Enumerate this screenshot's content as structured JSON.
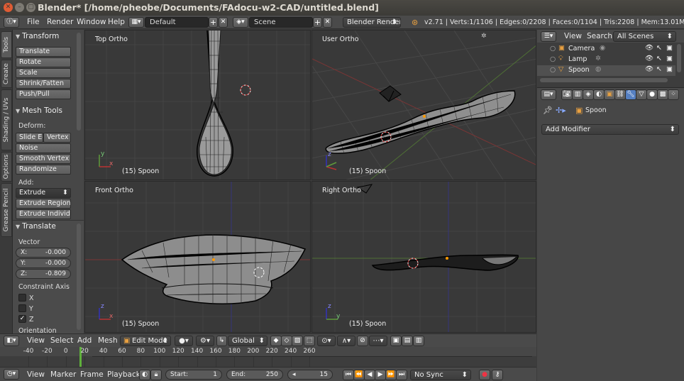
{
  "window": {
    "title": "Blender* [/home/pheobe/Documents/FAdocu-w2-CAD/untitled.blend]"
  },
  "info_header": {
    "menus": [
      "File",
      "Render",
      "Window",
      "Help"
    ],
    "layout": "Default",
    "scene": "Scene",
    "engine": "Blender Render",
    "stats": "v2.71 | Verts:1/1106 | Edges:0/2208 | Faces:0/1104 | Tris:2208 | Mem:13.01M | Spoon"
  },
  "tool_tabs": [
    "Tools",
    "Create",
    "Shading / UVs",
    "Options",
    "Grease Pencil"
  ],
  "toolshelf": {
    "transform": {
      "title": "Transform",
      "buttons": [
        "Translate",
        "Rotate",
        "Scale",
        "Shrink/Fatten",
        "Push/Pull"
      ]
    },
    "mesh_tools": {
      "title": "Mesh Tools",
      "deform_label": "Deform:",
      "slide_edge": "Slide Ed",
      "vertex": "Vertex",
      "noise": "Noise",
      "smooth_vertex": "Smooth Vertex",
      "randomize": "Randomize",
      "add_label": "Add:",
      "extrude": "Extrude",
      "extrude_region": "Extrude Region",
      "extrude_individual": "Extrude Individual"
    },
    "translate": {
      "title": "Translate",
      "vector_label": "Vector",
      "x": {
        "label": "X:",
        "value": "-0.000"
      },
      "y": {
        "label": "Y:",
        "value": "-0.000"
      },
      "z": {
        "label": "Z:",
        "value": "-0.809"
      },
      "constraint_label": "Constraint Axis",
      "axes": [
        {
          "label": "X",
          "checked": false
        },
        {
          "label": "Y",
          "checked": false
        },
        {
          "label": "Z",
          "checked": true
        }
      ],
      "orientation_label": "Orientation"
    }
  },
  "viewports": {
    "top": {
      "name": "Top Ortho",
      "object": "(15) Spoon"
    },
    "user": {
      "name": "User Ortho",
      "object": "(15) Spoon"
    },
    "front": {
      "name": "Front Ortho",
      "object": "(15) Spoon"
    },
    "right": {
      "name": "Right Ortho",
      "object": "(15) Spoon"
    }
  },
  "view3d_header": {
    "menus": [
      "View",
      "Select",
      "Add",
      "Mesh"
    ],
    "mode": "Edit Mode",
    "orientation": "Global"
  },
  "timeline": {
    "ticks": [
      "-40",
      "-20",
      "0",
      "20",
      "40",
      "60",
      "80",
      "100",
      "120",
      "140",
      "160",
      "180",
      "200",
      "220",
      "240",
      "260"
    ],
    "current_frame": 15,
    "menus": [
      "View",
      "Marker",
      "Frame",
      "Playback"
    ],
    "start": {
      "label": "Start:",
      "value": "1"
    },
    "end": {
      "label": "End:",
      "value": "250"
    },
    "frame": "15",
    "sync": "No Sync"
  },
  "outliner": {
    "view": "View",
    "search": "Search",
    "filter": "All Scenes",
    "items": [
      "Camera",
      "Lamp",
      "Spoon"
    ]
  },
  "properties": {
    "object": "Spoon",
    "add_modifier": "Add Modifier"
  },
  "colors": {
    "viewport_bg": "#393939",
    "grid": "#454545",
    "x_axis": "#8a3b3b",
    "y_axis": "#5f8a3b",
    "z_axis": "#3b3b9a",
    "accent_blue": "#5680c2"
  }
}
